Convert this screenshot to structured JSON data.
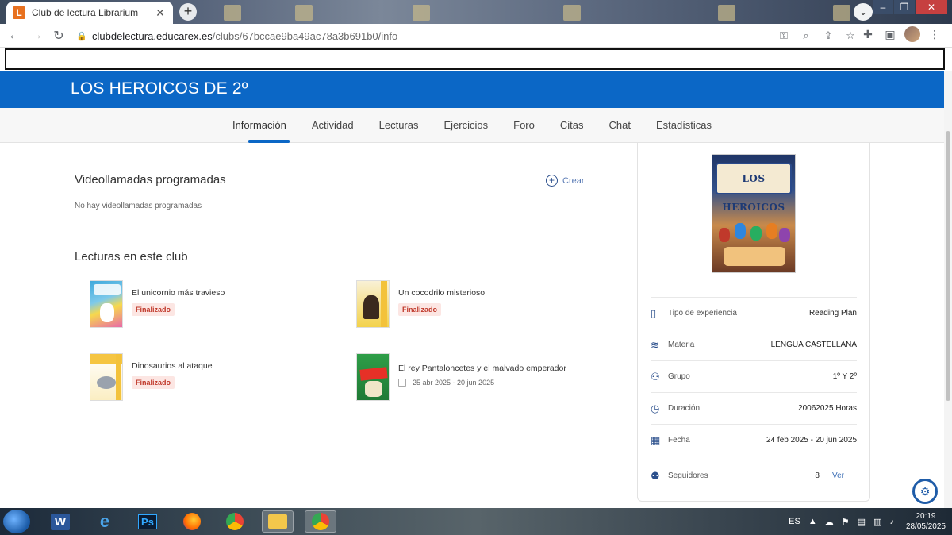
{
  "browser": {
    "tab_title": "Club de lectura Librarium",
    "favicon_letter": "L",
    "url_host": "clubdelectura.educarex.es",
    "url_path": "/clubs/67bccae9ba49ac78a3b691b0/info"
  },
  "club": {
    "title": "LOS HEROICOS DE 2º",
    "cover_text": "LOS HEROICOS"
  },
  "nav": {
    "tabs": [
      {
        "label": "Información"
      },
      {
        "label": "Actividad"
      },
      {
        "label": "Lecturas"
      },
      {
        "label": "Ejercicios"
      },
      {
        "label": "Foro"
      },
      {
        "label": "Citas"
      },
      {
        "label": "Chat"
      },
      {
        "label": "Estadísticas"
      }
    ]
  },
  "videocalls": {
    "title": "Videollamadas programadas",
    "empty": "No hay videollamadas programadas",
    "create_label": "Crear"
  },
  "readings": {
    "title": "Lecturas en este club",
    "books": [
      {
        "title": "El unicornio más travieso",
        "status": "Finalizado",
        "cover_color": "#3fa9dc"
      },
      {
        "title": "Un cocodrilo misterioso",
        "status": "Finalizado",
        "cover_color": "#f3d24b"
      },
      {
        "title": "Dinosaurios al ataque",
        "status": "Finalizado",
        "cover_color": "#f5c542"
      },
      {
        "title": "El rey Pantaloncetes y el malvado emperador",
        "dates": "25 abr 2025 - 20 jun 2025",
        "cover_color": "#2e9e48"
      }
    ]
  },
  "details": {
    "rows": [
      {
        "label": "Tipo de experiencia",
        "value": "Reading Plan",
        "icon": "book-icon"
      },
      {
        "label": "Materia",
        "value": "LENGUA CASTELLANA",
        "icon": "layers-icon"
      },
      {
        "label": "Grupo",
        "value": "1º Y 2º",
        "icon": "group-icon"
      },
      {
        "label": "Duración",
        "value": "20062025 Horas",
        "icon": "clock-icon"
      },
      {
        "label": "Fecha",
        "value": "24 feb 2025 - 20 jun 2025",
        "icon": "calendar-icon"
      },
      {
        "label": "Seguidores",
        "value": "8",
        "icon": "followers-icon",
        "link": "Ver"
      }
    ]
  },
  "taskbar": {
    "lang": "ES",
    "time": "20:19",
    "date": "28/05/2025"
  },
  "colors": {
    "brand_blue": "#0b67c6",
    "badge_bg": "#fce6e3",
    "badge_text": "#c0392b"
  }
}
